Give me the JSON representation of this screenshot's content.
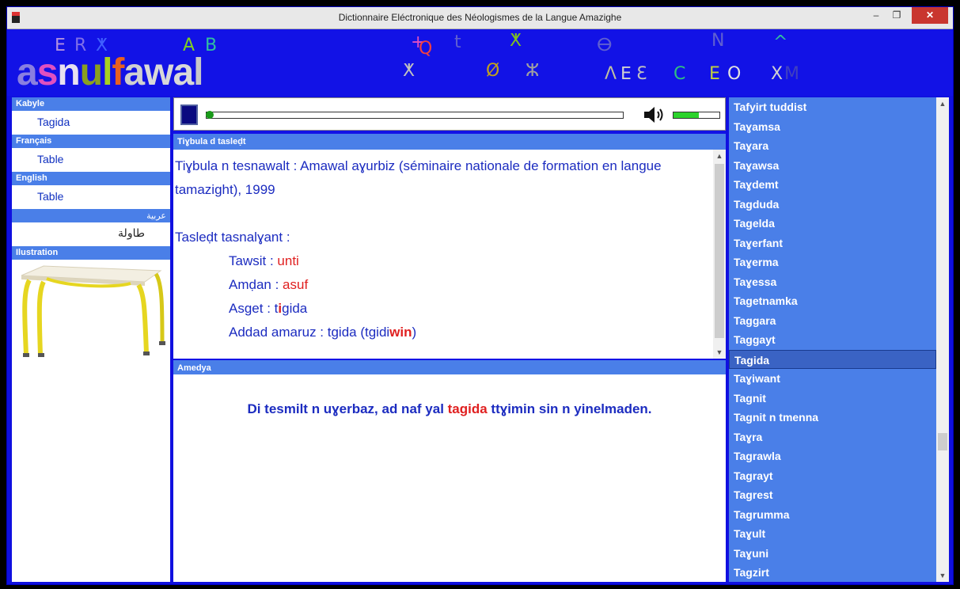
{
  "window": {
    "title": "Dictionnaire Eléctronique des Néologismes de la Langue Amazighe",
    "minimize": "–",
    "maximize": "❐",
    "close": "✕"
  },
  "banner": {
    "logo_letters": [
      {
        "ch": "a",
        "color": "#8a7fe0"
      },
      {
        "ch": "s",
        "color": "#e050c0"
      },
      {
        "ch": "n",
        "color": "#e8e0f0"
      },
      {
        "ch": "u",
        "color": "#8aa020"
      },
      {
        "ch": "l",
        "color": "#a8d020"
      },
      {
        "ch": "f",
        "color": "#e86020"
      },
      {
        "ch": "a",
        "color": "#d0d0d0"
      },
      {
        "ch": "w",
        "color": "#d8d8d8"
      },
      {
        "ch": "a",
        "color": "#d8d8d8"
      },
      {
        "ch": "l",
        "color": "#c8c8c8"
      }
    ],
    "glyphs": [
      {
        "t": "ⴹ",
        "c": "#b090e0"
      },
      {
        "t": "R",
        "c": "#7f6fe8"
      },
      {
        "t": "ⵅ",
        "c": "#4060ff"
      },
      {
        "t": "A",
        "c": "#7fd020"
      },
      {
        "t": "B",
        "c": "#30c0a0"
      },
      {
        "t": "+",
        "c": "#e050c0"
      },
      {
        "t": "Q",
        "c": "#f04040"
      },
      {
        "t": "ⵅ",
        "c": "#c0c0c0"
      },
      {
        "t": "t",
        "c": "#6060d0"
      },
      {
        "t": "ⵅ",
        "c": "#80c020"
      },
      {
        "t": "Ø",
        "c": "#c0a020"
      },
      {
        "t": "ⵣ",
        "c": "#a0a0a0"
      },
      {
        "t": "ⴱ",
        "c": "#6060d0"
      },
      {
        "t": "Λ",
        "c": "#c0c0a0"
      },
      {
        "t": "ⴹ",
        "c": "#d0d0d0"
      },
      {
        "t": "C",
        "c": "#30c080"
      },
      {
        "t": "Ɛ",
        "c": "#c0c0c0"
      },
      {
        "t": "N",
        "c": "#6060d0"
      },
      {
        "t": "E",
        "c": "#c0d040"
      },
      {
        "t": "O",
        "c": "#e0e0e0"
      },
      {
        "t": "^",
        "c": "#30c0a0"
      },
      {
        "t": "X",
        "c": "#d0d0d0"
      },
      {
        "t": "M",
        "c": "#4040c0"
      }
    ]
  },
  "left": {
    "kabyle_head": "Kabyle",
    "kabyle_val": "Tagida",
    "francais_head": "Français",
    "francais_val": "Table",
    "english_head": "English",
    "english_val": "Table",
    "arabic_head": "عربية",
    "arabic_val": "طاولة",
    "illustration_head": "Ilustration"
  },
  "player": {
    "progress": 0.0,
    "volume": 0.55
  },
  "center": {
    "source_head": "Tiɣbula d tasleḍt",
    "source_line": "Tiɣbula n tesnawalt : Amawal aɣurbiz  (séminaire nationale de formation en langue tamazight), 1999",
    "analysis_title": "Tasleḍt tasnalɣant :",
    "tawsit_label": "Tawsit : ",
    "tawsit_val": "unti",
    "amdan_label": "Amḍan : ",
    "amdan_val": "asuf",
    "asget_label": "Asget  : ",
    "asget_pre": "t",
    "asget_red": "i",
    "asget_post": "gida",
    "addad_label": "Addad amaruz : tgida (tgidi",
    "addad_red": "win",
    "addad_close": ")",
    "example_head": "Amedya",
    "example_pre": "Di tesmilt n uɣerbaz, ad naf yal ",
    "example_word": "tagida",
    "example_post": " ttɣimin sin n yinelmaden."
  },
  "wordlist": {
    "items": [
      "Tafyirt tuddist",
      "Taɣamsa",
      "Taɣara",
      "Taɣawsa",
      "Taɣdemt",
      "Tagduda",
      "Tagelda",
      "Taɣerfant",
      "Taɣerma",
      "Taɣessa",
      "Tagetnamka",
      "Taggara",
      "Taggayt",
      "Tagida",
      "Taɣiwant",
      "Tagnit",
      "Tagnit n tmenna",
      "Taɣra",
      "Tagrawla",
      "Tagrayt",
      "Tagrest",
      "Tagrumma",
      "Taɣult",
      "Taɣuni",
      "Tagzirt"
    ],
    "selected": "Tagida"
  },
  "colors": {
    "window_blue": "#1212e6",
    "header_blue": "#4a7fe8",
    "text_blue": "#1c2cc0",
    "accent_red": "#e02020",
    "volume_green": "#2bd32b"
  }
}
